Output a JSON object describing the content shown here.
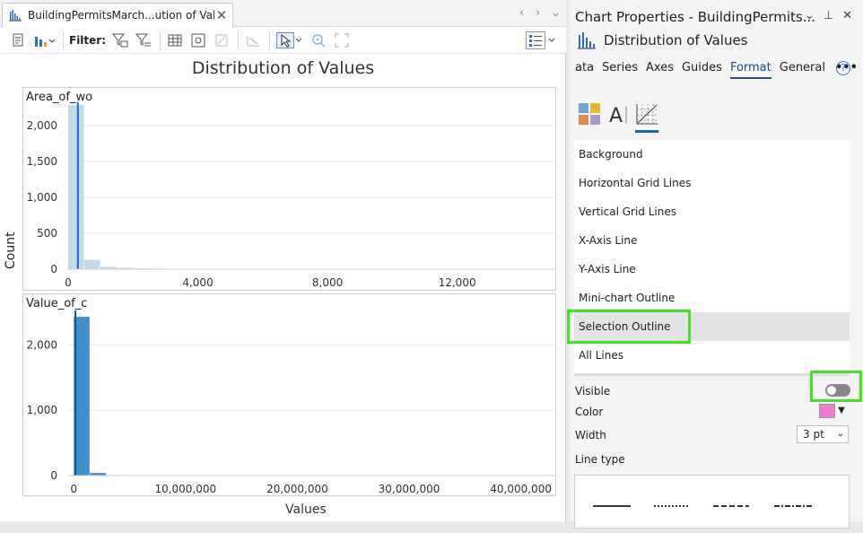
{
  "doc_tab": {
    "title": "BuildingPermitsMarch...ution of Values",
    "close": "✕"
  },
  "tab_nav": {
    "left": "‹",
    "right": "›",
    "menu": "⌄"
  },
  "toolbar": {
    "filter_label": "Filter:"
  },
  "chart": {
    "title": "Distribution of Values",
    "ylabel": "Count",
    "xlabel": "Values"
  },
  "chart_data": [
    {
      "type": "bar",
      "label": "Area_of_wo",
      "x_ticks": [
        "4,000",
        "8,000",
        "12,000"
      ],
      "x_tick_values": [
        4000,
        8000,
        12000
      ],
      "y_ticks": [
        "0",
        "500",
        "1,000",
        "1,500",
        "2,000"
      ],
      "y_tick_values": [
        0,
        500,
        1000,
        1500,
        2000
      ],
      "x_zero_label": "0",
      "xlim": [
        0,
        15000
      ],
      "ylim": [
        0,
        2300
      ],
      "bin_width": 500,
      "values": [
        2290,
        130,
        35,
        20,
        12,
        9,
        7,
        6,
        5,
        4,
        4,
        3,
        3,
        2,
        2,
        2,
        1,
        1,
        1,
        1,
        1,
        1,
        1,
        1,
        1,
        1,
        1,
        1,
        1,
        1
      ],
      "mean_line": 300,
      "color": "#bfdbea",
      "line_color": "#1a66d0"
    },
    {
      "type": "bar",
      "label": "Value_of_c",
      "x_ticks": [
        "0",
        "10,000,000",
        "20,000,000",
        "30,000,000",
        "40,000,000"
      ],
      "x_tick_values": [
        0,
        10000000,
        20000000,
        30000000,
        40000000
      ],
      "y_ticks": [
        "0",
        "1,000",
        "2,000"
      ],
      "y_tick_values": [
        0,
        1000,
        2000
      ],
      "xlim": [
        -500000,
        43000000
      ],
      "ylim": [
        0,
        2500
      ],
      "bin_width": 1450000,
      "values": [
        2430,
        40,
        8,
        5,
        4,
        3,
        3,
        2,
        2,
        2,
        1,
        1,
        1,
        1,
        1,
        1,
        1,
        1,
        1,
        1,
        1,
        1,
        1,
        1,
        1,
        1,
        1,
        1,
        1,
        1
      ],
      "mean_line": 150000,
      "color": "#3f8fcc",
      "line_color": "#1a4f8a"
    }
  ],
  "right_pane": {
    "title": "Chart Properties - BuildingPermits...",
    "subtitle": "Distribution of Values",
    "ctrl_dropdown": "⌄",
    "ctrl_pin": "⊥",
    "ctrl_close": "✕",
    "tabs": [
      "ata",
      "Series",
      "Axes",
      "Guides",
      "Format",
      "General"
    ],
    "more": "•••",
    "help": "?",
    "elements": [
      "Background",
      "Horizontal Grid Lines",
      "Vertical Grid Lines",
      "X-Axis Line",
      "Y-Axis Line",
      "Mini-chart Outline",
      "Selection Outline",
      "All Lines"
    ],
    "visible_label": "Visible",
    "color_label": "Color",
    "color_value": "#f07ad8",
    "width_label": "Width",
    "width_value": "3 pt",
    "linetype_label": "Line type"
  }
}
